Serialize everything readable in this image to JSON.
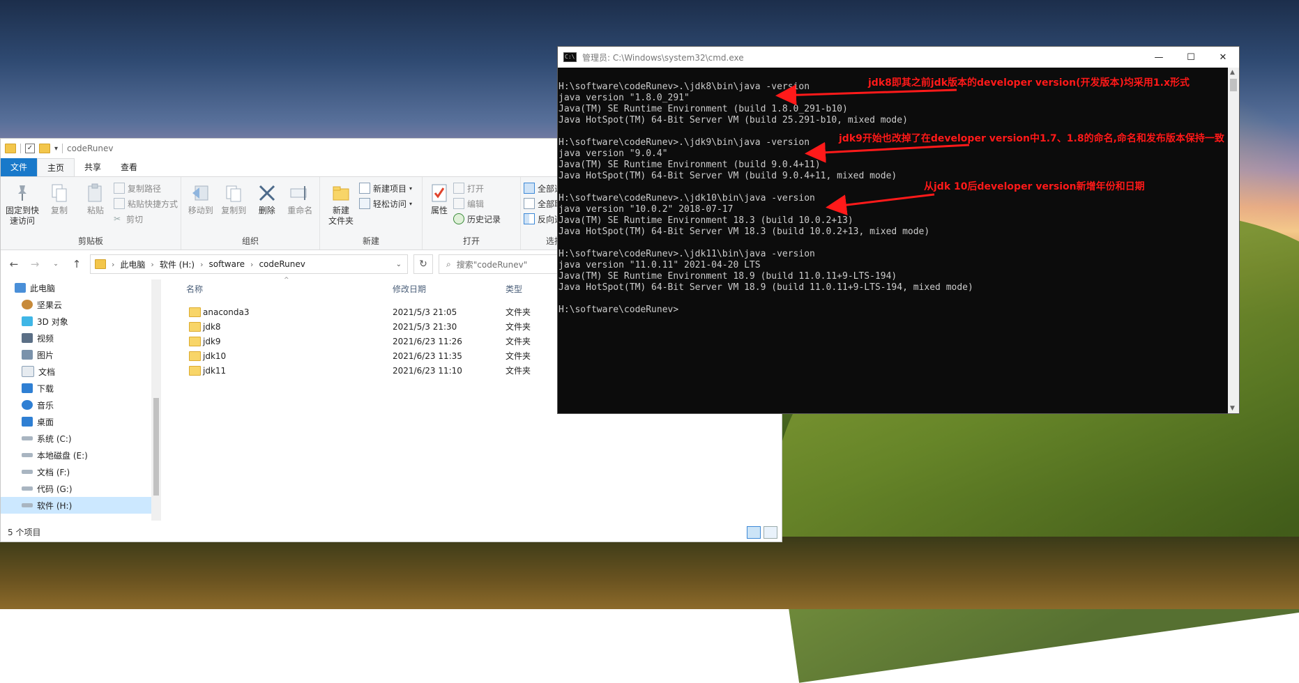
{
  "explorer": {
    "title": "codeRunev",
    "quick_access_check": "✓",
    "quick_access_dropdown": "▾",
    "tabs": [
      "文件",
      "主页",
      "共享",
      "查看"
    ],
    "ribbon": {
      "clipboard": {
        "label": "剪贴板",
        "pin": "固定到快\n速访问",
        "copy": "复制",
        "paste": "粘贴",
        "copy_path": "复制路径",
        "paste_shortcut": "粘贴快捷方式",
        "cut": "剪切"
      },
      "organize": {
        "label": "组织",
        "move_to": "移动到",
        "copy_to": "复制到",
        "delete": "删除",
        "rename": "重命名"
      },
      "new": {
        "label": "新建",
        "new_folder": "新建\n文件夹",
        "new_item": "新建项目",
        "easy_access": "轻松访问"
      },
      "open": {
        "label": "打开",
        "properties": "属性",
        "open": "打开",
        "edit": "编辑",
        "history": "历史记录"
      },
      "select": {
        "label": "选择",
        "select_all": "全部选择",
        "select_none": "全部取消",
        "invert": "反向选择"
      }
    },
    "address": {
      "crumbs": [
        "此电脑",
        "软件 (H:)",
        "software",
        "codeRunev"
      ],
      "separator": "›",
      "search_placeholder": "搜索\"codeRunev\""
    },
    "nav": [
      "此电脑",
      "坚果云",
      "3D 对象",
      "视频",
      "图片",
      "文档",
      "下载",
      "音乐",
      "桌面",
      "系统 (C:)",
      "本地磁盘 (E:)",
      "文档 (F:)",
      "代码 (G:)",
      "软件 (H:)"
    ],
    "columns": {
      "name": "名称",
      "date": "修改日期",
      "type": "类型"
    },
    "files": [
      {
        "name": "anaconda3",
        "date": "2021/5/3 21:05",
        "type": "文件夹"
      },
      {
        "name": "jdk8",
        "date": "2021/5/3 21:30",
        "type": "文件夹"
      },
      {
        "name": "jdk9",
        "date": "2021/6/23 11:26",
        "type": "文件夹"
      },
      {
        "name": "jdk10",
        "date": "2021/6/23 11:35",
        "type": "文件夹"
      },
      {
        "name": "jdk11",
        "date": "2021/6/23 11:10",
        "type": "文件夹"
      }
    ],
    "status": "5 个项目"
  },
  "cmd": {
    "title": "管理员: C:\\Windows\\system32\\cmd.exe",
    "icon_text": "C:\\",
    "lines": [
      "",
      "H:\\software\\codeRunev>.\\jdk8\\bin\\java -version",
      "java version \"1.8.0_291\"",
      "Java(TM) SE Runtime Environment (build 1.8.0_291-b10)",
      "Java HotSpot(TM) 64-Bit Server VM (build 25.291-b10, mixed mode)",
      "",
      "H:\\software\\codeRunev>.\\jdk9\\bin\\java -version",
      "java version \"9.0.4\"",
      "Java(TM) SE Runtime Environment (build 9.0.4+11)",
      "Java HotSpot(TM) 64-Bit Server VM (build 9.0.4+11, mixed mode)",
      "",
      "H:\\software\\codeRunev>.\\jdk10\\bin\\java -version",
      "java version \"10.0.2\" 2018-07-17",
      "Java(TM) SE Runtime Environment 18.3 (build 10.0.2+13)",
      "Java HotSpot(TM) 64-Bit Server VM 18.3 (build 10.0.2+13, mixed mode)",
      "",
      "H:\\software\\codeRunev>.\\jdk11\\bin\\java -version",
      "java version \"11.0.11\" 2021-04-20 LTS",
      "Java(TM) SE Runtime Environment 18.9 (build 11.0.11+9-LTS-194)",
      "Java HotSpot(TM) 64-Bit Server VM 18.9 (build 11.0.11+9-LTS-194, mixed mode)",
      "",
      "H:\\software\\codeRunev>"
    ]
  },
  "annotations": [
    "jdk8即其之前jdk版本的developer version(开发版本)均采用1.x形式",
    "jdk9开始也改掉了在developer version中1.7、1.8的命名,命名和发布版本保持一致",
    "从jdk 10后developer version新增年份和日期"
  ],
  "colors": {
    "annotation": "#ff1a1a",
    "file_tab": "#1979ca",
    "selection": "#cce8ff"
  }
}
